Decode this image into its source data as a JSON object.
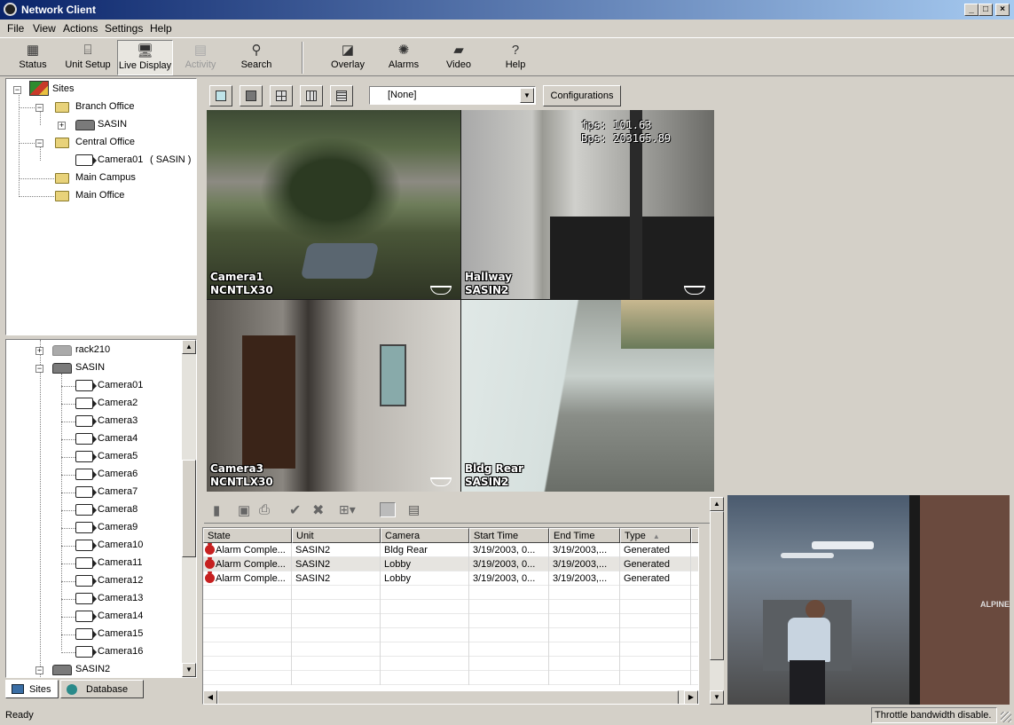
{
  "window": {
    "title": "Network Client",
    "controls": [
      "minimize",
      "maximize",
      "close"
    ]
  },
  "menu": [
    "File",
    "View",
    "Actions",
    "Settings",
    "Help"
  ],
  "toolbar": [
    {
      "label": "Status",
      "icon": "status-icon"
    },
    {
      "label": "Unit Setup",
      "icon": "unit-setup-icon"
    },
    {
      "label": "Live Display",
      "icon": "live-display-icon",
      "active": true
    },
    {
      "label": "Activity",
      "icon": "activity-icon",
      "disabled": true
    },
    {
      "label": "Search",
      "icon": "search-icon"
    },
    {
      "label": "Overlay",
      "icon": "overlay-icon"
    },
    {
      "label": "Alarms",
      "icon": "alarms-icon"
    },
    {
      "label": "Video",
      "icon": "video-icon"
    },
    {
      "label": "Help",
      "icon": "help-icon"
    }
  ],
  "sites_tree": {
    "root": "Sites",
    "branch_office": "Branch Office",
    "branch_unit": "SASIN",
    "central_office": "Central Office",
    "central_camera": "Camera01",
    "central_camera_unit": "( SASIN )",
    "main_campus": "Main Campus",
    "main_office": "Main Office"
  },
  "unit_tree": {
    "rack": "rack210",
    "unit": "SASIN",
    "cameras": [
      "Camera01",
      "Camera2",
      "Camera3",
      "Camera4",
      "Camera5",
      "Camera6",
      "Camera7",
      "Camera8",
      "Camera9",
      "Camera10",
      "Camera11",
      "Camera12",
      "Camera13",
      "Camera14",
      "Camera15",
      "Camera16"
    ],
    "unit2": "SASIN2"
  },
  "left_tabs": {
    "sites": "Sites",
    "database": "Database"
  },
  "layout_bar": {
    "buttons": [
      "layout-1x1-button",
      "layout-single-button",
      "layout-2x2-button",
      "layout-3x3-button",
      "layout-4x4-button"
    ],
    "preset_value": "[None]",
    "configurations_label": "Configurations"
  },
  "tiles": [
    {
      "camera": "Camera1",
      "unit": "NCNTLX30",
      "ptz": true
    },
    {
      "camera": "Hallway",
      "unit": "SASIN2",
      "ptz": true,
      "fps": "fps: 101.63",
      "bps": "Bps: 203165.89"
    },
    {
      "camera": "Camera3",
      "unit": "NCNTLX30",
      "ptz": true
    },
    {
      "camera": "Bldg Rear",
      "unit": "SASIN2",
      "ptz": false
    }
  ],
  "alarm_toolbar": [
    "clear-icon",
    "save-icon",
    "print-icon",
    "acknowledge-icon",
    "delete-icon",
    "network-dropdown-icon",
    "view-clip-icon",
    "properties-icon"
  ],
  "alarm_table": {
    "columns": [
      "State",
      "Unit",
      "Camera",
      "Start Time",
      "End Time",
      "Type"
    ],
    "sort_column": "Type",
    "rows": [
      {
        "state": "Alarm Comple...",
        "unit": "SASIN2",
        "camera": "Bldg Rear",
        "start": "3/19/2003, 0...",
        "end": "3/19/2003,...",
        "type": "Generated"
      },
      {
        "state": "Alarm Comple...",
        "unit": "SASIN2",
        "camera": "Lobby",
        "start": "3/19/2003, 0...",
        "end": "3/19/2003,...",
        "type": "Generated"
      },
      {
        "state": "Alarm Comple...",
        "unit": "SASIN2",
        "camera": "Lobby",
        "start": "3/19/2003, 0...",
        "end": "3/19/2003,...",
        "type": "Generated"
      }
    ]
  },
  "preview_overlay_text": "ALPINE",
  "statusbar": {
    "left": "Ready",
    "right": "Throttle bandwidth disable."
  }
}
